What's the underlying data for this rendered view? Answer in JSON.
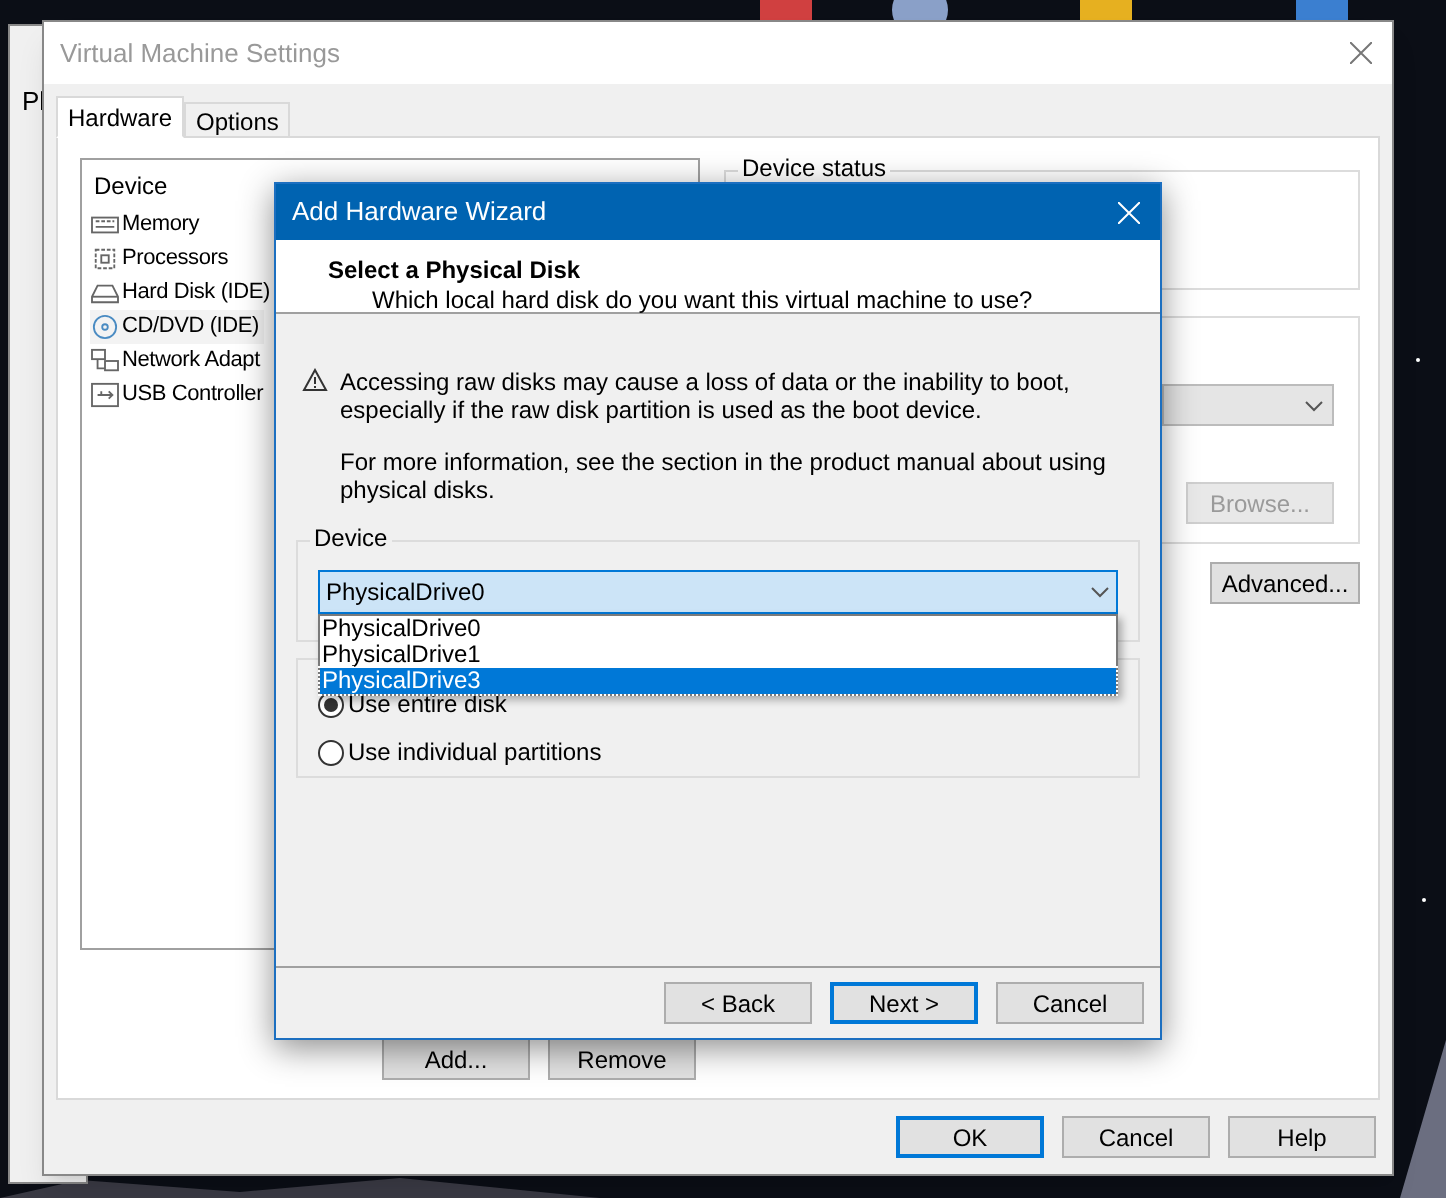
{
  "background_window": {
    "title_fragment": "Pl"
  },
  "settings": {
    "title": "Virtual Machine Settings",
    "tabs": [
      {
        "label": "Hardware",
        "selected": true
      },
      {
        "label": "Options",
        "selected": false
      }
    ],
    "device_list": {
      "column": "Device",
      "items": [
        {
          "name": "Memory",
          "kind": "memory",
          "selected": false
        },
        {
          "name": "Processors",
          "kind": "cpu",
          "selected": false
        },
        {
          "name": "Hard Disk (IDE)",
          "kind": "disk",
          "selected": false
        },
        {
          "name": "CD/DVD (IDE)",
          "kind": "cd",
          "selected": true
        },
        {
          "name": "Network Adapt",
          "kind": "network",
          "selected": false
        },
        {
          "name": "USB Controller",
          "kind": "usb",
          "selected": false
        }
      ]
    },
    "device_status": {
      "title": "Device status"
    },
    "browse_button": {
      "label": "Browse...",
      "disabled": true
    },
    "advanced_button": {
      "label": "Advanced..."
    },
    "list_buttons": [
      {
        "label": "Add..."
      },
      {
        "label": "Remove"
      }
    ],
    "buttons": [
      {
        "label": "OK",
        "default": true
      },
      {
        "label": "Cancel",
        "default": false
      },
      {
        "label": "Help",
        "default": false
      }
    ]
  },
  "wizard": {
    "title": "Add Hardware Wizard",
    "heading": "Select a Physical Disk",
    "subheading": "Which local hard disk do you want this virtual machine to use?",
    "warning": "Accessing raw disks may cause a loss of data or the inability to boot, especially if the raw disk partition is used as the boot device.",
    "info": "For more information, see the section in the product manual about using physical disks.",
    "device_group": {
      "label": "Device",
      "value": "PhysicalDrive0",
      "expanded": true,
      "options": [
        {
          "label": "PhysicalDrive0",
          "highlighted": false
        },
        {
          "label": "PhysicalDrive1",
          "highlighted": false
        },
        {
          "label": "PhysicalDrive3",
          "highlighted": true
        }
      ]
    },
    "usage": [
      {
        "label": "Use entire disk",
        "selected": true
      },
      {
        "label": "Use individual partitions",
        "selected": false
      }
    ],
    "buttons": [
      {
        "label": "< Back",
        "default": false
      },
      {
        "label": "Next >",
        "default": true
      },
      {
        "label": "Cancel",
        "default": false
      }
    ]
  }
}
